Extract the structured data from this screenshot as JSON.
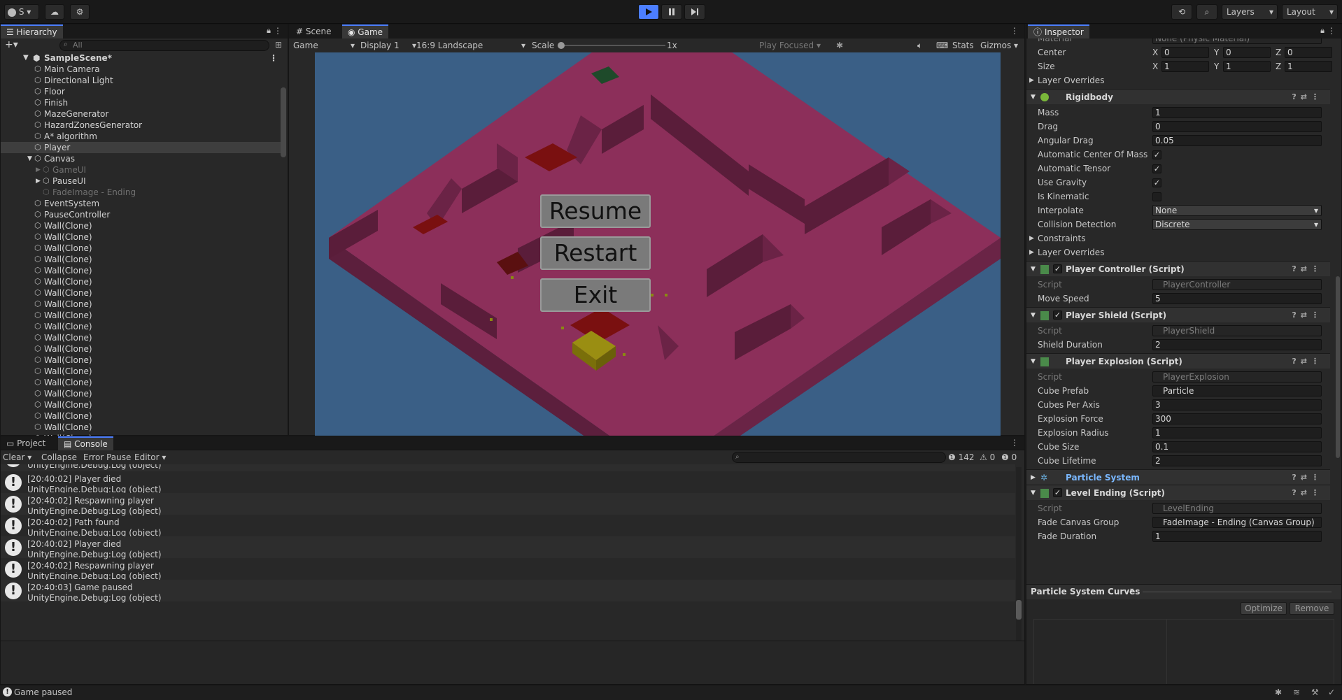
{
  "toolbar": {
    "account_label": "S",
    "layers_label": "Layers",
    "layout_label": "Layout"
  },
  "hierarchy": {
    "tab_label": "Hierarchy",
    "search_placeholder": "All",
    "scene_name": "SampleScene*",
    "items": [
      {
        "label": "Main Camera",
        "depth": 1,
        "state": "normal"
      },
      {
        "label": "Directional Light",
        "depth": 1,
        "state": "normal"
      },
      {
        "label": "Floor",
        "depth": 1,
        "state": "normal"
      },
      {
        "label": "Finish",
        "depth": 1,
        "state": "normal"
      },
      {
        "label": "MazeGenerator",
        "depth": 1,
        "state": "normal"
      },
      {
        "label": "HazardZonesGenerator",
        "depth": 1,
        "state": "normal"
      },
      {
        "label": "A* algorithm",
        "depth": 1,
        "state": "normal"
      },
      {
        "label": "Player",
        "depth": 1,
        "state": "selected"
      },
      {
        "label": "Canvas",
        "depth": 1,
        "state": "expanded"
      },
      {
        "label": "GameUI",
        "depth": 2,
        "state": "dim-collapsed"
      },
      {
        "label": "PauseUI",
        "depth": 2,
        "state": "collapsed"
      },
      {
        "label": "FadeImage - Ending",
        "depth": 2,
        "state": "dim"
      },
      {
        "label": "EventSystem",
        "depth": 1,
        "state": "normal"
      },
      {
        "label": "PauseController",
        "depth": 1,
        "state": "normal"
      },
      {
        "label": "Wall(Clone)",
        "depth": 1,
        "state": "normal"
      },
      {
        "label": "Wall(Clone)",
        "depth": 1,
        "state": "normal"
      },
      {
        "label": "Wall(Clone)",
        "depth": 1,
        "state": "normal"
      },
      {
        "label": "Wall(Clone)",
        "depth": 1,
        "state": "normal"
      },
      {
        "label": "Wall(Clone)",
        "depth": 1,
        "state": "normal"
      },
      {
        "label": "Wall(Clone)",
        "depth": 1,
        "state": "normal"
      },
      {
        "label": "Wall(Clone)",
        "depth": 1,
        "state": "normal"
      },
      {
        "label": "Wall(Clone)",
        "depth": 1,
        "state": "normal"
      },
      {
        "label": "Wall(Clone)",
        "depth": 1,
        "state": "normal"
      },
      {
        "label": "Wall(Clone)",
        "depth": 1,
        "state": "normal"
      },
      {
        "label": "Wall(Clone)",
        "depth": 1,
        "state": "normal"
      },
      {
        "label": "Wall(Clone)",
        "depth": 1,
        "state": "normal"
      },
      {
        "label": "Wall(Clone)",
        "depth": 1,
        "state": "normal"
      },
      {
        "label": "Wall(Clone)",
        "depth": 1,
        "state": "normal"
      },
      {
        "label": "Wall(Clone)",
        "depth": 1,
        "state": "normal"
      },
      {
        "label": "Wall(Clone)",
        "depth": 1,
        "state": "normal"
      },
      {
        "label": "Wall(Clone)",
        "depth": 1,
        "state": "normal"
      },
      {
        "label": "Wall(Clone)",
        "depth": 1,
        "state": "normal"
      },
      {
        "label": "Wall(Clone)",
        "depth": 1,
        "state": "normal"
      },
      {
        "label": "Wall(Clone)",
        "depth": 1,
        "state": "normal"
      }
    ]
  },
  "game_view": {
    "tabs": [
      "Scene",
      "Game"
    ],
    "display_mode": "Game",
    "display": "Display 1",
    "aspect": "16:9 Landscape",
    "scale_label": "Scale",
    "scale_value": "1x",
    "play_focused": "Play Focused",
    "stats": "Stats",
    "gizmos": "Gizmos",
    "buttons": [
      "Resume",
      "Restart",
      "Exit"
    ]
  },
  "inspector": {
    "tab_label": "Inspector",
    "partial_top": "None (Physic Material)",
    "collider": {
      "center_label": "Center",
      "center": [
        "0",
        "0",
        "0"
      ],
      "size_label": "Size",
      "size": [
        "1",
        "1",
        "1"
      ],
      "layer_overrides": "Layer Overrides"
    },
    "axes": [
      "X",
      "Y",
      "Z"
    ],
    "rigidbody": {
      "title": "Rigidbody",
      "mass_label": "Mass",
      "mass": "1",
      "drag_label": "Drag",
      "drag": "0",
      "angular_drag_label": "Angular Drag",
      "angular_drag": "0.05",
      "auto_com_label": "Automatic Center Of Mass",
      "auto_tensor_label": "Automatic Tensor",
      "use_gravity_label": "Use Gravity",
      "is_kinematic_label": "Is Kinematic",
      "interpolate_label": "Interpolate",
      "interpolate": "None",
      "collision_label": "Collision Detection",
      "collision": "Discrete",
      "constraints": "Constraints",
      "layer_overrides": "Layer Overrides"
    },
    "player_controller": {
      "title": "Player Controller (Script)",
      "script_label": "Script",
      "script": "PlayerController",
      "move_speed_label": "Move Speed",
      "move_speed": "5"
    },
    "player_shield": {
      "title": "Player Shield (Script)",
      "script_label": "Script",
      "script": "PlayerShield",
      "duration_label": "Shield Duration",
      "duration": "2"
    },
    "player_explosion": {
      "title": "Player Explosion (Script)",
      "script_label": "Script",
      "script": "PlayerExplosion",
      "cube_prefab_label": "Cube Prefab",
      "cube_prefab": "Particle",
      "cubes_per_axis_label": "Cubes Per Axis",
      "cubes_per_axis": "3",
      "force_label": "Explosion Force",
      "force": "300",
      "radius_label": "Explosion Radius",
      "radius": "1",
      "cube_size_label": "Cube Size",
      "cube_size": "0.1",
      "lifetime_label": "Cube Lifetime",
      "lifetime": "2"
    },
    "particle_system": {
      "title": "Particle System"
    },
    "level_ending": {
      "title": "Level Ending (Script)",
      "script_label": "Script",
      "script": "LevelEnding",
      "fade_group_label": "Fade Canvas Group",
      "fade_group": "FadeImage - Ending (Canvas Group)",
      "fade_duration_label": "Fade Duration",
      "fade_duration": "1"
    },
    "curves": {
      "title": "Particle System Curves",
      "optimize": "Optimize",
      "remove": "Remove"
    }
  },
  "console": {
    "tabs": [
      "Project",
      "Console"
    ],
    "clear": "Clear",
    "collapse": "Collapse",
    "error_pause": "Error Pause",
    "editor": "Editor",
    "count_log": "142",
    "count_warn": "0",
    "count_err": "0",
    "partial_top": "UnityEngine.Debug:Log (object)",
    "entries": [
      {
        "msg": "[20:40:02] Player died",
        "trace": "UnityEngine.Debug:Log (object)"
      },
      {
        "msg": "[20:40:02] Respawning player",
        "trace": "UnityEngine.Debug:Log (object)"
      },
      {
        "msg": "[20:40:02] Path found",
        "trace": "UnityEngine.Debug:Log (object)"
      },
      {
        "msg": "[20:40:02] Player died",
        "trace": "UnityEngine.Debug:Log (object)"
      },
      {
        "msg": "[20:40:02] Respawning player",
        "trace": "UnityEngine.Debug:Log (object)"
      },
      {
        "msg": "[20:40:03] Game paused",
        "trace": "UnityEngine.Debug:Log (object)"
      }
    ]
  },
  "status_bar": {
    "message": "Game paused"
  },
  "colors": {
    "accent": "#4c7eff",
    "maze_floor": "#8c2f5a",
    "sky": "#3a5f86",
    "pause_button": "#7a7a7a"
  }
}
